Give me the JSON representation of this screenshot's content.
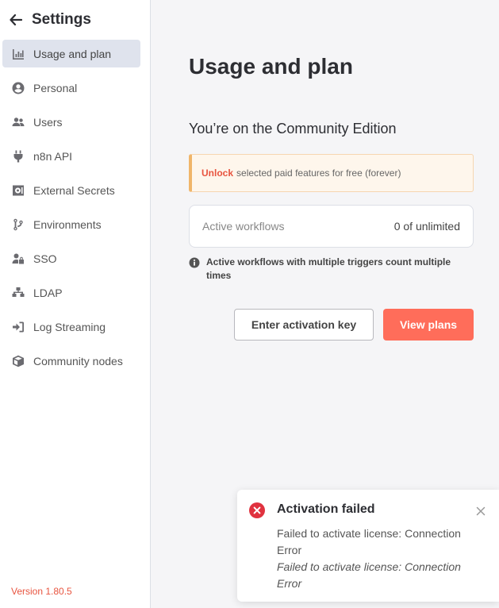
{
  "sidebar": {
    "title": "Settings",
    "items": [
      {
        "label": "Usage and plan",
        "icon": "chart-bar-icon",
        "active": true
      },
      {
        "label": "Personal",
        "icon": "user-circle-icon"
      },
      {
        "label": "Users",
        "icon": "user-friends-icon"
      },
      {
        "label": "n8n API",
        "icon": "plug-icon"
      },
      {
        "label": "External Secrets",
        "icon": "vault-icon"
      },
      {
        "label": "Environments",
        "icon": "code-branch-icon"
      },
      {
        "label": "SSO",
        "icon": "user-lock-icon"
      },
      {
        "label": "LDAP",
        "icon": "network-wired-icon"
      },
      {
        "label": "Log Streaming",
        "icon": "sign-in-icon"
      },
      {
        "label": "Community nodes",
        "icon": "cube-icon"
      }
    ],
    "version": "Version 1.80.5"
  },
  "main": {
    "title": "Usage and plan",
    "edition": "You’re on the Community Edition",
    "notice": {
      "highlight": "Unlock",
      "text": "selected paid features for free (forever)"
    },
    "usage": {
      "label": "Active workflows",
      "value": "0 of unlimited"
    },
    "info": "Active workflows with multiple triggers count multiple times",
    "buttons": {
      "activation": "Enter activation key",
      "plans": "View plans"
    }
  },
  "toast": {
    "title": "Activation failed",
    "message": "Failed to activate license: Connection Error",
    "detail": "Failed to activate license: Connection Error"
  },
  "colors": {
    "accent": "#ff6d5a",
    "error": "#e0323f",
    "version": "#e8543f"
  }
}
